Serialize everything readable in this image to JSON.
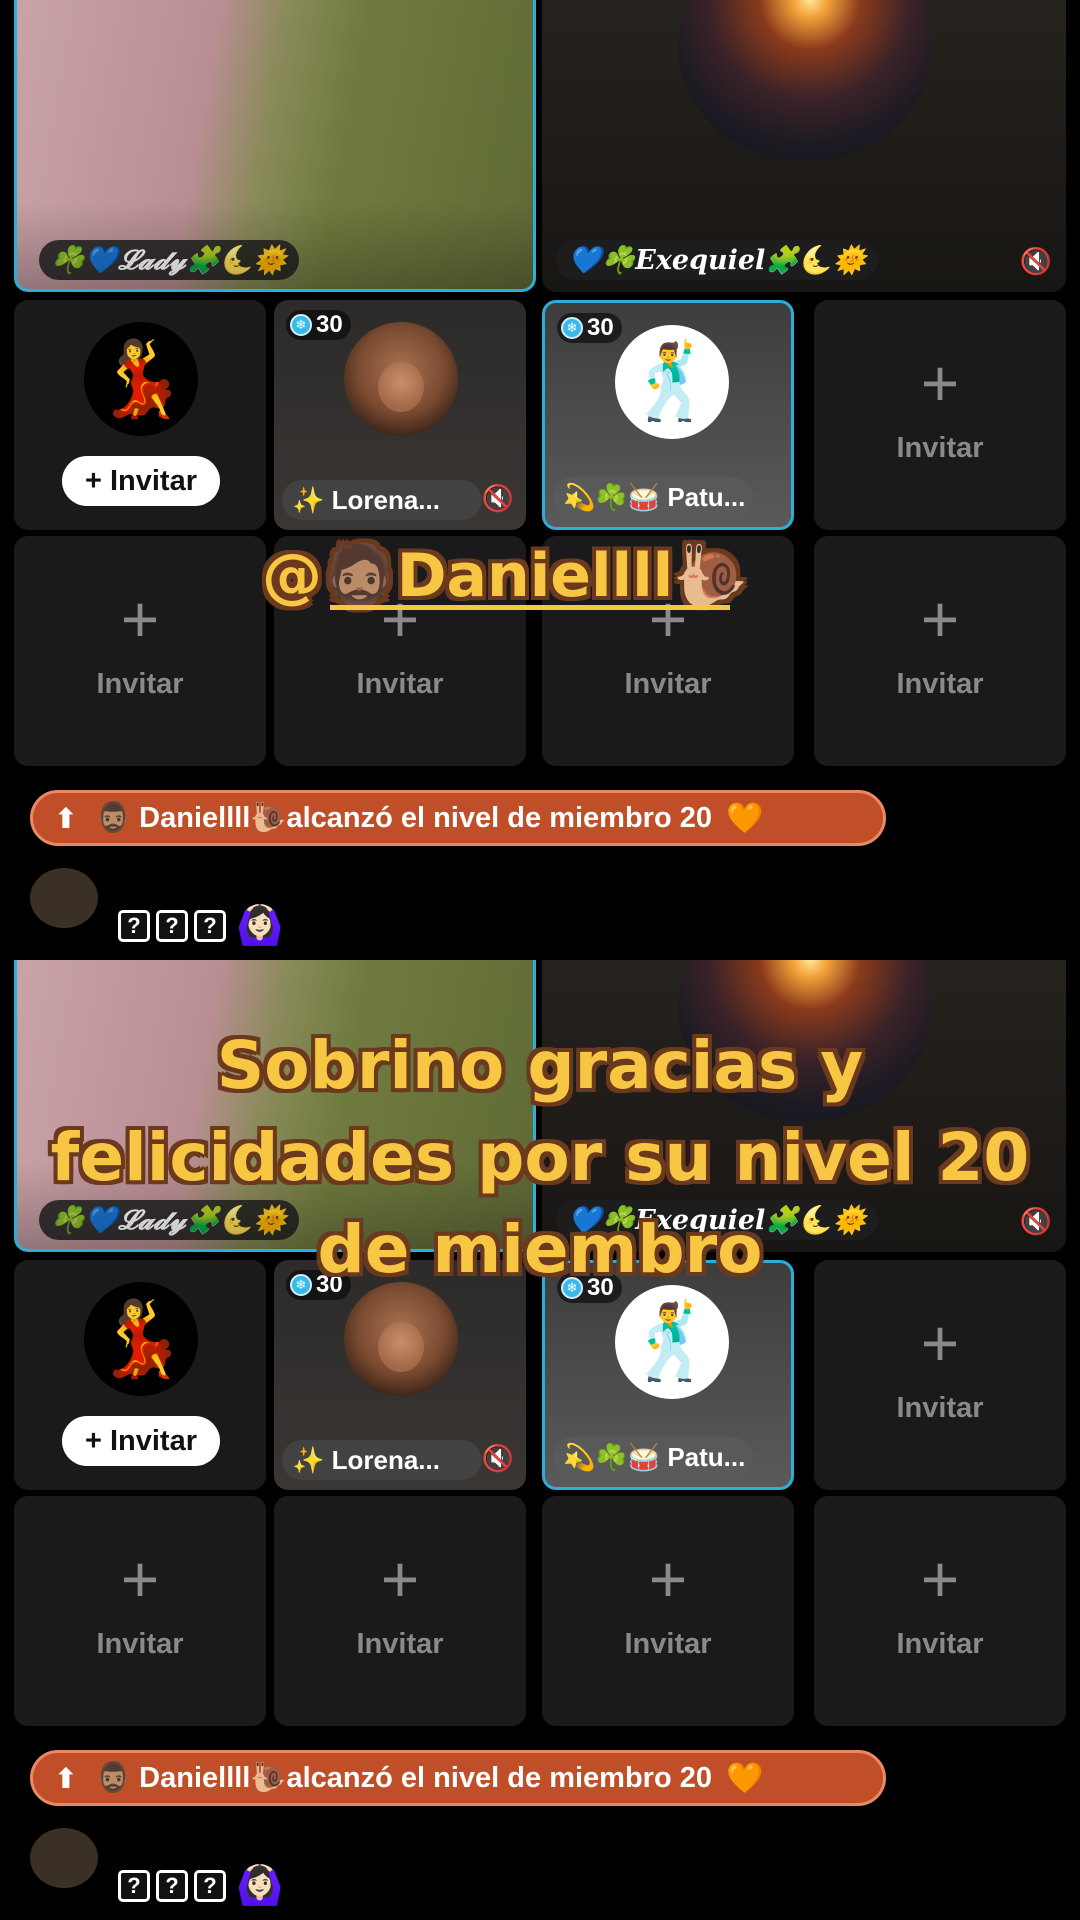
{
  "room": {
    "host_video": {
      "name": "☘️💙𝓛𝓪𝓭𝔂🧩🌜🌞"
    },
    "cohost_video": {
      "name": "💙☘️𝑬𝒙𝒆𝒒𝒖𝒊𝒆𝒍🧩🌜🌞"
    },
    "viewer_slot": {
      "avatar_emoji": "💃",
      "invite_button": "+ Invitar"
    },
    "guests": [
      {
        "level": "30",
        "name": "✨ Lorena...",
        "muted": true
      },
      {
        "level": "30",
        "name": "💫☘️🥁 Patu...",
        "muted": false
      }
    ],
    "empty_slot": {
      "plus": "+",
      "label": "Invitar"
    }
  },
  "banner": {
    "user": "🧔🏽‍♂️ Daniellll🐌",
    "text": " alcanzó el nivel de miembro 20",
    "heart": "🧡"
  },
  "comment": {
    "boxes": [
      "?",
      "?",
      "?"
    ],
    "emoji": "🙆🏻‍♀️"
  },
  "overlay": {
    "mention": "@🧔🏽Daniellll🐌",
    "caption": "Sobrino gracias y felicidades por su nivel 20 de miembro"
  },
  "colors": {
    "accent_border": "#2ab0d8",
    "banner_bg": "#c04e28",
    "overlay_text": "#f7c744",
    "overlay_outline": "#6b3a1e"
  }
}
